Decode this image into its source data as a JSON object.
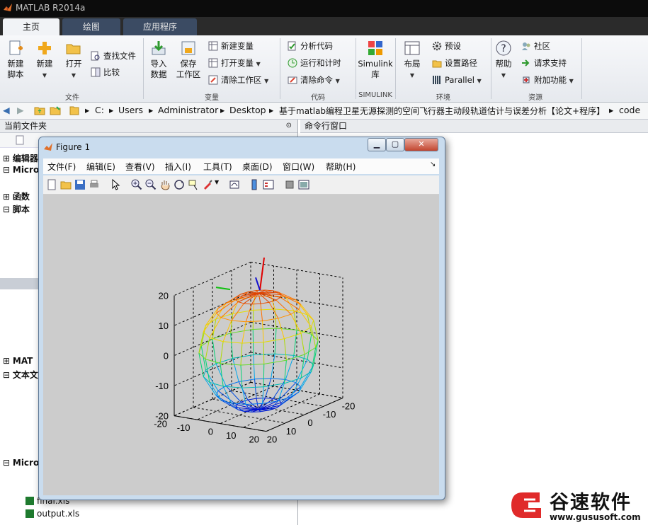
{
  "app": {
    "title": "MATLAB R2014a"
  },
  "tabs": [
    {
      "label": "主页",
      "active": true
    },
    {
      "label": "绘图",
      "active": false
    },
    {
      "label": "应用程序",
      "active": false
    }
  ],
  "ribbon": {
    "file": {
      "new_script": "新建\n脚本",
      "new_script_l1": "新建",
      "new_script_l2": "脚本",
      "new": "新建",
      "open": "打开",
      "find_files": "查找文件",
      "compare": "比较",
      "group_label": "文件"
    },
    "variable": {
      "import_l1": "导入",
      "import_l2": "数据",
      "save_l1": "保存",
      "save_l2": "工作区",
      "new_var": "新建变量",
      "open_var": "打开变量",
      "clear_ws": "清除工作区",
      "group_label": "变量"
    },
    "code": {
      "analyze": "分析代码",
      "run_time": "运行和计时",
      "clear_cmd": "清除命令",
      "group_label": "代码"
    },
    "simulink": {
      "lib_l1": "Simulink",
      "lib_l2": "库",
      "group_label": "SIMULINK"
    },
    "env": {
      "layout": "布局",
      "prefs": "预设",
      "set_path": "设置路径",
      "parallel": "Parallel",
      "group_label": "环境"
    },
    "resources": {
      "help": "帮助",
      "community": "社区",
      "support": "请求支持",
      "addons": "附加功能",
      "group_label": "资源"
    }
  },
  "address": {
    "segments": [
      "C:",
      "Users",
      "Administrator",
      "Desktop",
      "基于matlab编程卫星无源探测的空间飞行器主动段轨道估计与误差分析【论文+程序】",
      "code"
    ]
  },
  "left_panel": {
    "title": "当前文件夹",
    "tree": [
      {
        "label": "编辑器",
        "y": 0
      },
      {
        "label": "Micro",
        "y": 0
      },
      {
        "label": "函数",
        "y": 0
      },
      {
        "label": "脚本",
        "y": 0
      },
      {
        "label": "MAT",
        "y": 0
      },
      {
        "label": "文本文",
        "y": 0
      },
      {
        "label": "Micro",
        "y": 0
      }
    ],
    "files": [
      "final.xls",
      "output.xls"
    ]
  },
  "command_window": {
    "title": "命令行窗口"
  },
  "figure": {
    "title": "Figure 1",
    "menu": [
      "文件(F)",
      "编辑(E)",
      "查看(V)",
      "插入(I)",
      "工具(T)",
      "桌面(D)",
      "窗口(W)",
      "帮助(H)"
    ],
    "z_ticks": [
      "20",
      "10",
      "0",
      "-10",
      "-20"
    ],
    "left_ticks": [
      "20",
      "10",
      "0",
      "-10",
      "-20"
    ],
    "right_ticks": [
      "20",
      "10",
      "0",
      "-10",
      "-20"
    ]
  },
  "brand": {
    "name": "谷速软件",
    "url": "www.gususoft.com"
  }
}
